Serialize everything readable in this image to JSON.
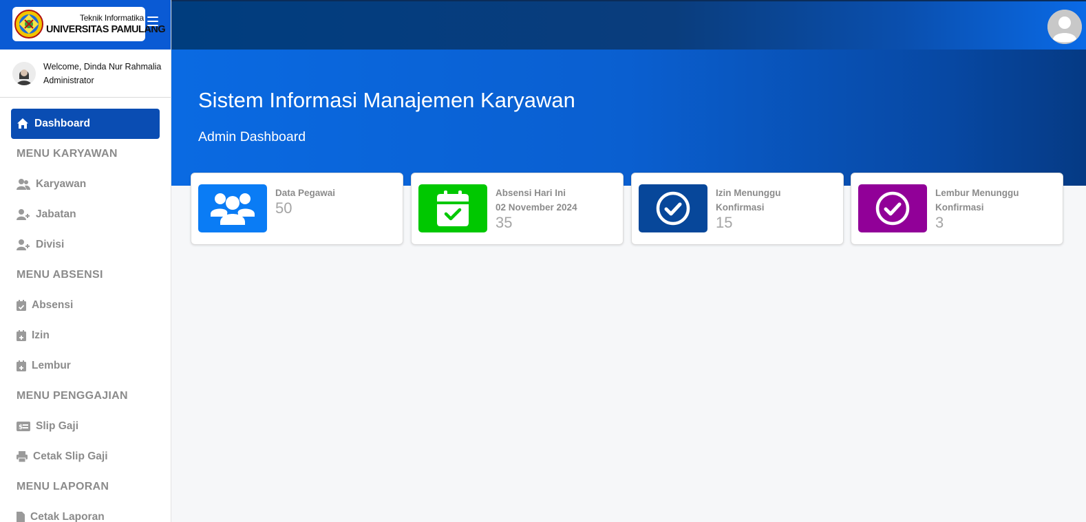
{
  "brand": {
    "line1": "Teknik Informatika",
    "line2": "UNIVERSITAS PAMULANG"
  },
  "user": {
    "welcome": "Welcome, Dinda Nur Rahmalia",
    "role": "Administrator"
  },
  "nav": {
    "active": "Dashboard",
    "sections": [
      {
        "title": "MENU KARYAWAN",
        "items": [
          "Karyawan",
          "Jabatan",
          "Divisi"
        ]
      },
      {
        "title": "MENU ABSENSI",
        "items": [
          "Absensi",
          "Izin",
          "Lembur"
        ]
      },
      {
        "title": "MENU PENGGAJIAN",
        "items": [
          "Slip Gaji",
          "Cetak Slip Gaji"
        ]
      },
      {
        "title": "MENU LAPORAN",
        "items": [
          "Cetak Laporan"
        ]
      }
    ]
  },
  "hero": {
    "title": "Sistem Informasi Manajemen Karyawan",
    "subtitle": "Admin Dashboard"
  },
  "cards": [
    {
      "label": "Data Pegawai",
      "value": "50",
      "color": "#0a7cf5",
      "icon": "users-icon"
    },
    {
      "label": "Absensi Hari Ini",
      "label2": "02 November 2024",
      "value": "35",
      "color": "#00c800",
      "icon": "calendar-check-icon"
    },
    {
      "label": "Izin Menunggu",
      "label2": "Konfirmasi",
      "value": "15",
      "color": "#07479a",
      "icon": "check-circle-icon"
    },
    {
      "label": "Lembur Menunggu",
      "label2": "Konfirmasi",
      "value": "3",
      "color": "#910098",
      "icon": "check-circle-icon"
    }
  ],
  "colors": {
    "sidebar_active": "#0a4db3",
    "muted_text": "#8b8b8b"
  }
}
